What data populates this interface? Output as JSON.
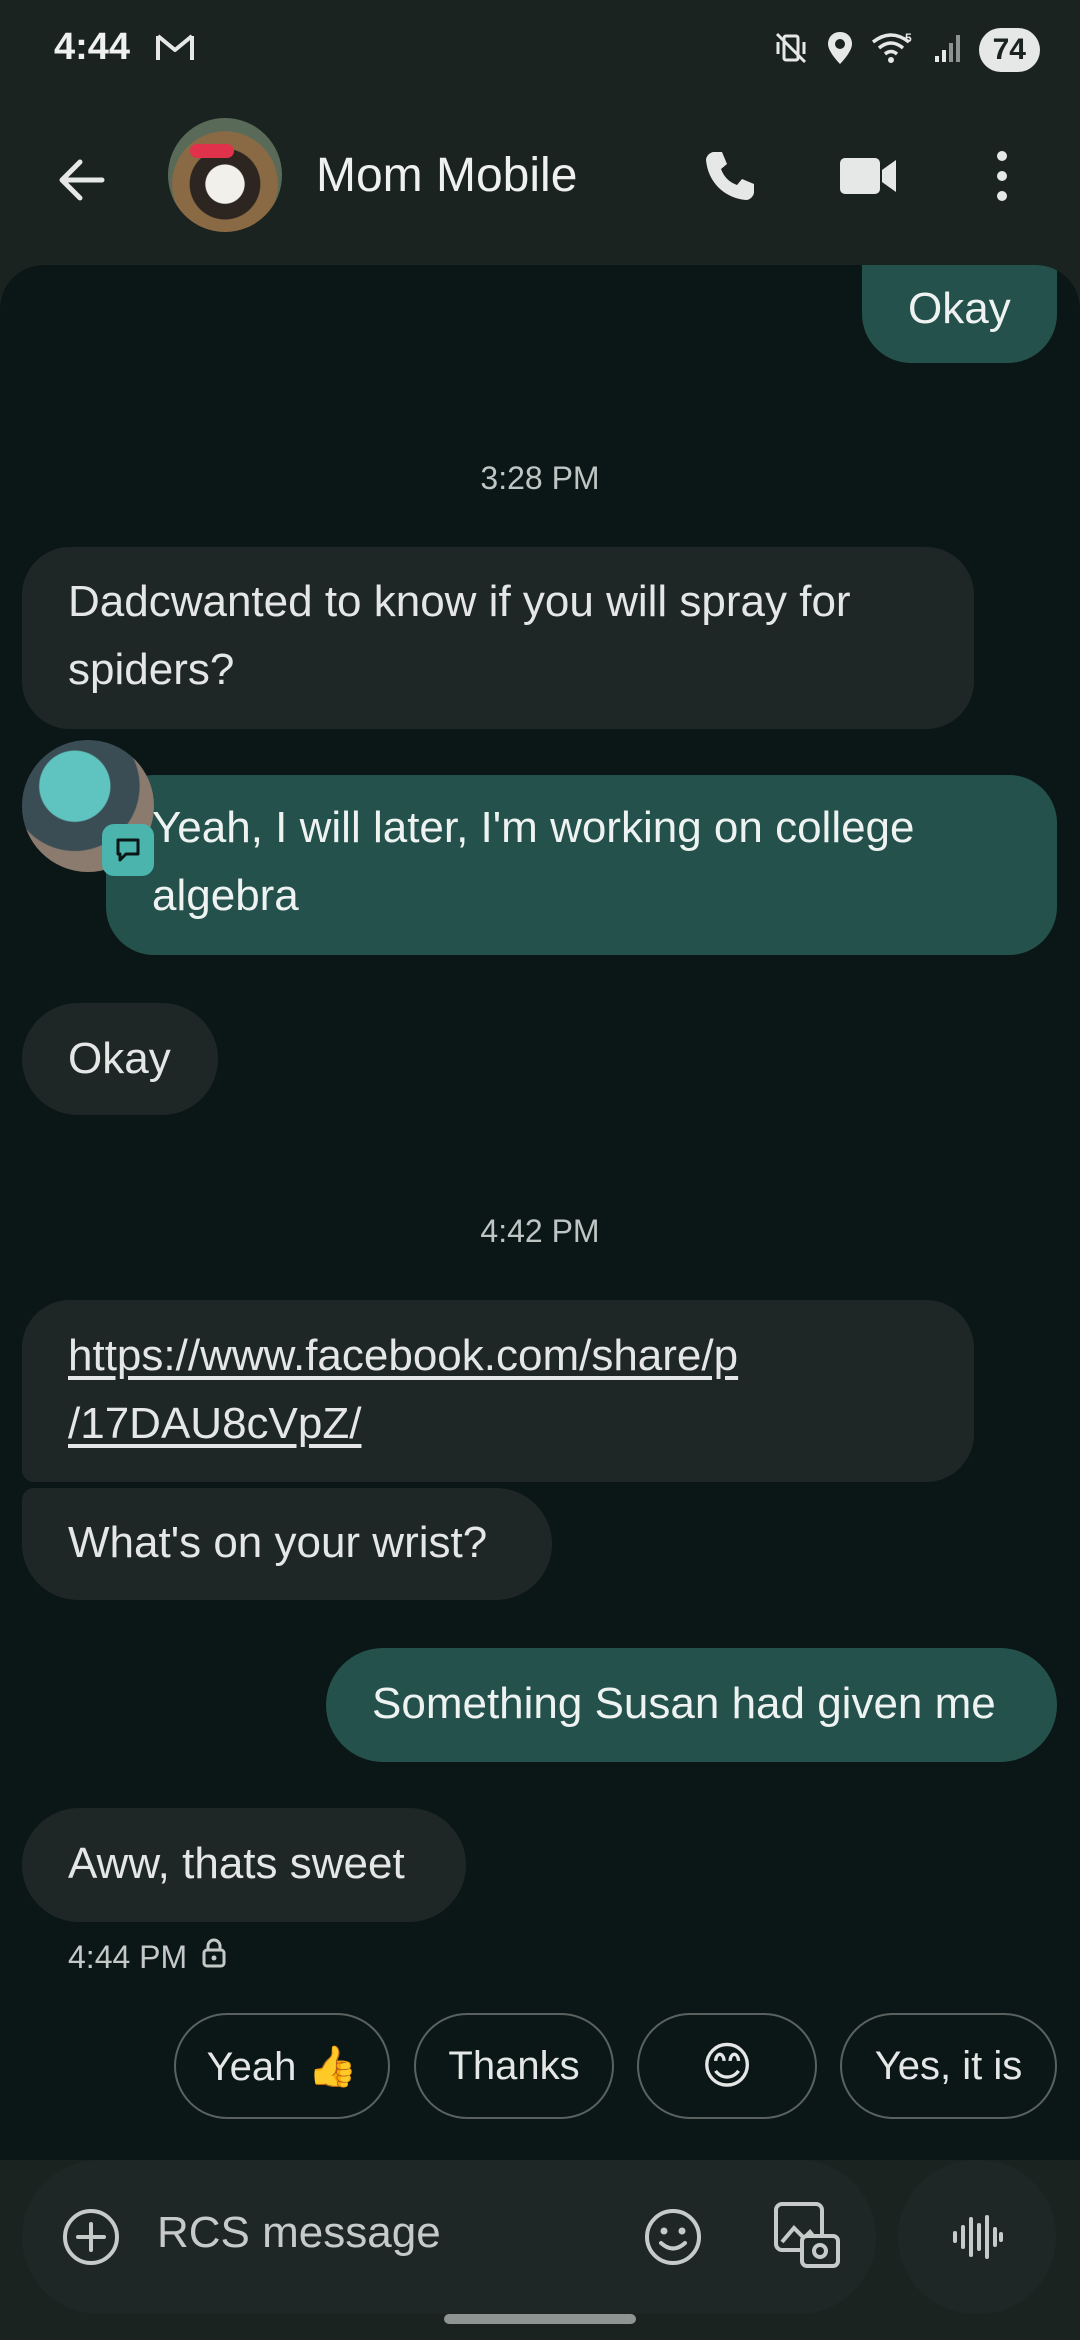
{
  "status_bar": {
    "time": "4:44",
    "battery": "74",
    "icons": [
      "gmail-icon",
      "vibrate-off-icon",
      "location-icon",
      "wifi-5g-icon",
      "signal-icon",
      "battery-icon"
    ]
  },
  "header": {
    "contact_name": "Mom Mobile",
    "icons": [
      "back-arrow-icon",
      "phone-icon",
      "video-call-icon",
      "more-vert-icon"
    ]
  },
  "messages": [
    {
      "direction": "out",
      "text": "Okay"
    },
    {
      "type": "timestamp",
      "text": "3:28 PM"
    },
    {
      "direction": "in",
      "lines": [
        "Dadcwanted to know if you will spray for",
        "spiders?"
      ]
    },
    {
      "direction": "out",
      "lines": [
        "Yeah, I will later, I'm working on college",
        "algebra"
      ]
    },
    {
      "direction": "in",
      "text": "Okay"
    },
    {
      "type": "timestamp",
      "text": "4:42 PM"
    },
    {
      "direction": "in",
      "lines": [
        "https://www.facebook.com/share/p",
        "/17DAU8cVpZ/"
      ],
      "is_link": true
    },
    {
      "direction": "in",
      "text": "What's on your wrist?"
    },
    {
      "direction": "out",
      "text": "Something Susan had given me"
    },
    {
      "direction": "in",
      "text": "Aww, thats sweet"
    }
  ],
  "last_message_meta": {
    "time": "4:44 PM",
    "icon": "lock-icon"
  },
  "smart_replies": [
    "Yeah 👍",
    "Thanks",
    "😊",
    "Yes, it is"
  ],
  "compose": {
    "placeholder": "RCS message",
    "icons": [
      "add-circle-icon",
      "emoji-icon",
      "gallery-icon",
      "voice-icon"
    ]
  },
  "colors": {
    "background": "#0b1716",
    "incoming_bubble": "#1f2726",
    "outgoing_bubble": "#24514c",
    "accent": "#4bb4ad"
  }
}
